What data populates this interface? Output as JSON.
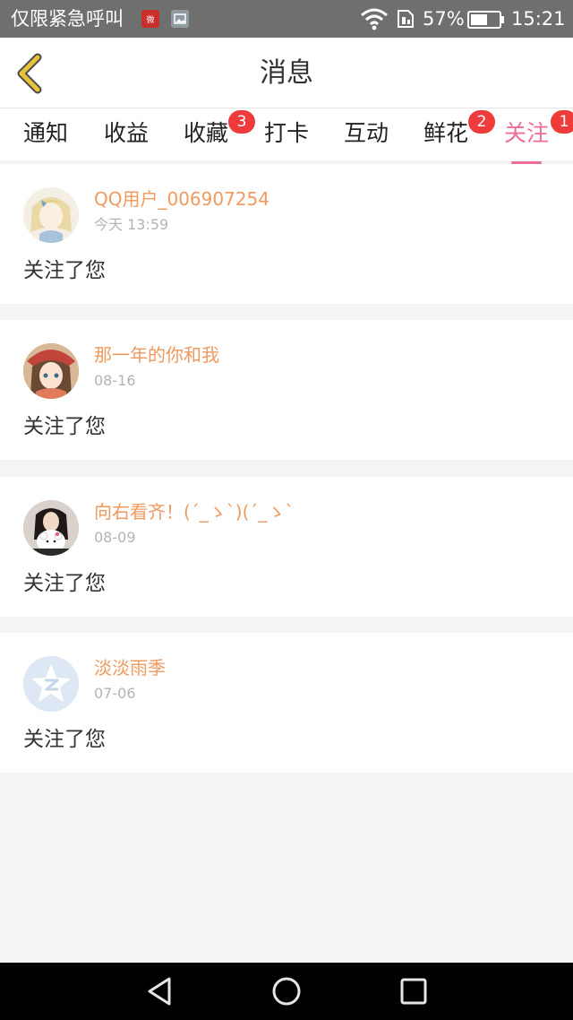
{
  "status_bar": {
    "carrier_text": "仅限紧急呼叫",
    "app_icon_1": "Weibo-style red icon",
    "app_icon_2": "image icon",
    "battery_percent": "57%",
    "time": "15:21",
    "icons": [
      "wifi-icon",
      "sim-icon",
      "battery-icon"
    ]
  },
  "header": {
    "back_icon": "chevron-left-icon",
    "title": "消息"
  },
  "tabs": [
    {
      "label": "通知",
      "badge": ""
    },
    {
      "label": "收益",
      "badge": ""
    },
    {
      "label": "收藏",
      "badge": "3"
    },
    {
      "label": "打卡",
      "badge": ""
    },
    {
      "label": "互动",
      "badge": ""
    },
    {
      "label": "鲜花",
      "badge": "2"
    },
    {
      "label": "关注",
      "badge": "1",
      "active": true
    }
  ],
  "messages": [
    {
      "user": "QQ用户_006907254",
      "date": "今天 13:59",
      "action": "关注了您"
    },
    {
      "user": "那一年的你和我",
      "date": "08-16",
      "action": "关注了您"
    },
    {
      "user": "向右看齐！(´_ゝ`)(´_ゝ`",
      "date": "08-09",
      "action": "关注了您"
    },
    {
      "user": "淡淡雨季",
      "date": "07-06",
      "action": "关注了您"
    }
  ],
  "nav": {
    "icons": [
      "back-triangle-icon",
      "home-circle-icon",
      "recents-square-icon"
    ]
  },
  "colors": {
    "accent": "#ef6c9a",
    "username": "#ef9a5f",
    "badge": "#ee3b3b",
    "back_arrow": "#e8c23a"
  }
}
